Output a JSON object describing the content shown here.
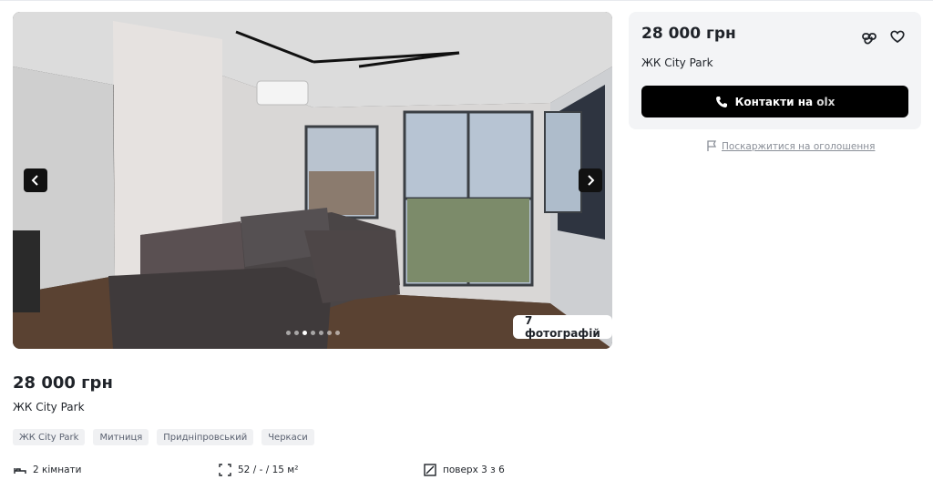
{
  "gallery": {
    "photo_count_label": "7 фотографій",
    "dots_total": 7,
    "dots_active_index": 2
  },
  "card": {
    "price": "28 000 грн",
    "subtitle": "ЖК City Park",
    "contact_label": "Контакти на ",
    "contact_masked": "olx"
  },
  "report": {
    "label": "Поскаржитися на оголошення"
  },
  "listing": {
    "price": "28 000 грн",
    "subtitle": "ЖК City Park",
    "tags": [
      "ЖК City Park",
      "Митниця",
      "Придніпровський",
      "Черкаси"
    ],
    "features": {
      "rooms": "2 кімнати",
      "area": "52 / - / 15 м²",
      "floor": "поверх 3 з 6"
    }
  },
  "icons": {
    "prev": "chevron-left-icon",
    "next": "chevron-right-icon",
    "link": "link-icon",
    "favorite": "heart-icon",
    "phone": "phone-icon",
    "report": "flag-icon",
    "rooms": "bed-icon",
    "area": "area-icon",
    "floor": "floor-icon"
  },
  "colors": {
    "button": "#000000",
    "card_bg": "#f3f4f6",
    "tag_bg": "#f0f1f3"
  }
}
